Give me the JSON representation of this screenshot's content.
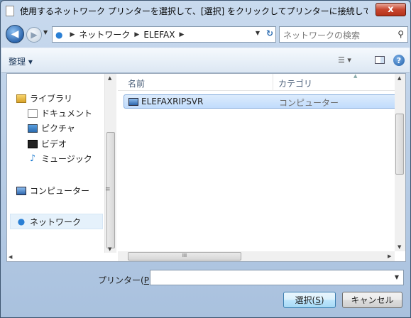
{
  "title": "使用するネットワーク プリンターを選択して、[選択] をクリックしてプリンターに接続してくだ...",
  "close_glyph": "x",
  "address": {
    "breadcrumbs": [
      "ネットワーク",
      "ELEFAX"
    ],
    "search_placeholder": "ネットワークの検索"
  },
  "toolbar": {
    "organize_label": "整理 ▾",
    "help_glyph": "?"
  },
  "nav": {
    "libraries": "ライブラリ",
    "documents": "ドキュメント",
    "pictures": "ピクチャ",
    "videos": "ビデオ",
    "music": "ミュージック",
    "computer": "コンピューター",
    "network": "ネットワーク"
  },
  "list": {
    "columns": [
      "名前",
      "カテゴリ"
    ],
    "rows": [
      {
        "name": "ELEFAXRIPSVR",
        "category": "コンピューター"
      }
    ],
    "hscroll_grip": "III"
  },
  "printer": {
    "label_prefix": "プリンター(",
    "label_key": "P",
    "label_suffix": ")",
    "value": ""
  },
  "buttons": {
    "select_prefix": "選択(",
    "select_key": "S",
    "select_suffix": ")",
    "cancel": "キャンセル"
  }
}
